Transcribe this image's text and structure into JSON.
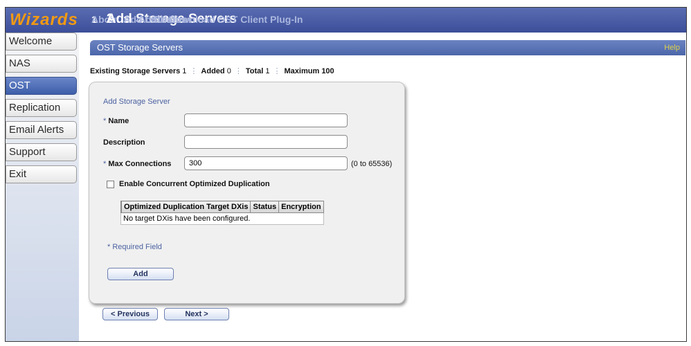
{
  "logo": "Wizards",
  "steps": [
    {
      "num": "1",
      "label": "About"
    },
    {
      "num": "2",
      "label": "Add Storage Servers"
    },
    {
      "num": "3",
      "label": "Add LSU's"
    },
    {
      "num": "4",
      "label": "Add Users"
    },
    {
      "num": "5",
      "label": "Confirm"
    },
    {
      "num": "6",
      "label": "Download OST Client Plug-In"
    }
  ],
  "nav": [
    "Welcome",
    "NAS",
    "OST",
    "Replication",
    "Email Alerts",
    "Support",
    "Exit"
  ],
  "header": {
    "title": "OST Storage Servers",
    "help": "Help"
  },
  "counts": {
    "existing_label": "Existing Storage Servers",
    "existing": "1",
    "added_label": "Added",
    "added": "0",
    "total_label": "Total",
    "total": "1",
    "max_label": "Maximum",
    "max": "100"
  },
  "form": {
    "title": "Add Storage Server",
    "name_label": "Name",
    "description_label": "Description",
    "max_conn_label": "Max Connections",
    "max_conn_value": "300",
    "max_conn_hint": "(0 to 65536)",
    "required_marker": "*",
    "concurrent_label": "Enable Concurrent Optimized Duplication"
  },
  "table": {
    "headers": [
      "Optimized Duplication Target DXis",
      "Status",
      "Encryption"
    ],
    "empty": "No target DXis have been configured."
  },
  "required_note": "* Required Field",
  "buttons": {
    "add": "Add",
    "previous": "< Previous",
    "next": "Next >"
  },
  "colors": {
    "logo": "#f29a13",
    "header_bar": "#4b66aa",
    "help": "#e2d44a"
  }
}
